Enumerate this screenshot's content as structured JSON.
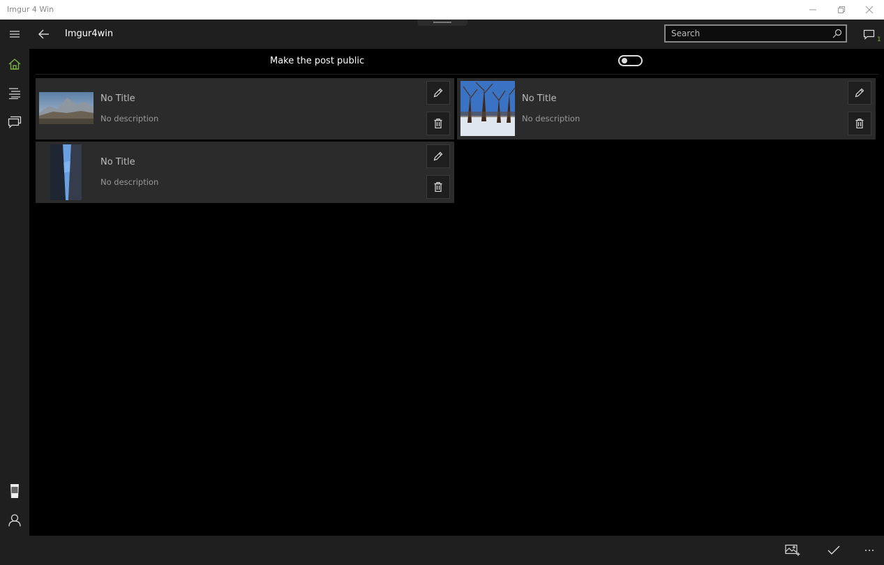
{
  "window": {
    "title": "Imgur 4 Win"
  },
  "header": {
    "app_title": "Imgur4win",
    "search_placeholder": "Search",
    "feedback_count": "1"
  },
  "toggle_row": {
    "label": "Make the post public",
    "is_on": false
  },
  "cards": [
    {
      "title": "No Title",
      "description": "No description"
    },
    {
      "title": "No Title",
      "description": "No description"
    },
    {
      "title": "No Title",
      "description": "No description"
    }
  ],
  "icons": {
    "nav": [
      "home-icon",
      "list-icon",
      "messages-icon",
      "beer-icon",
      "user-icon",
      "gear-icon"
    ],
    "bottom": [
      "add-image-icon",
      "check-icon",
      "more-icon"
    ]
  },
  "colors": {
    "accent": "#7cb342",
    "chrome": "#1f1f1f",
    "card": "#2b2b2b"
  }
}
